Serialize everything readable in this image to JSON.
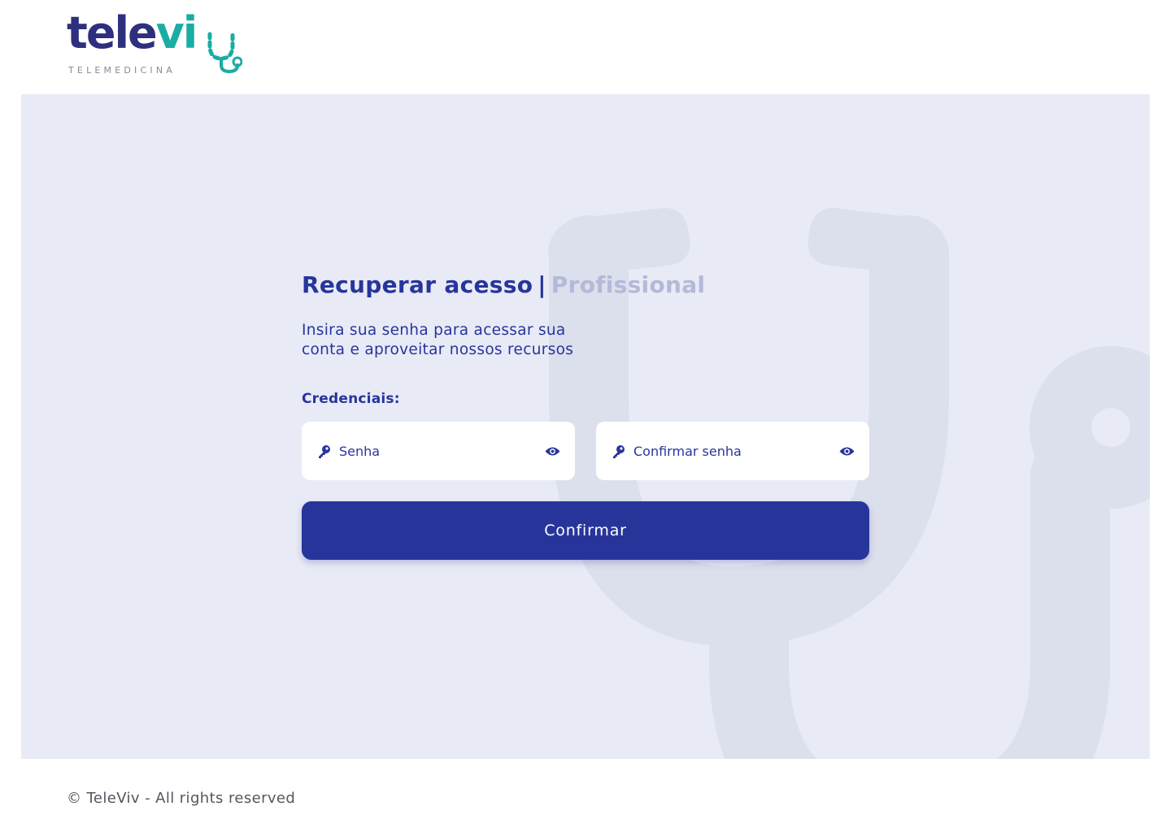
{
  "brand": {
    "logo_word_dark": "tele",
    "logo_word_teal": "vi",
    "logo_subtitle": "TELEMEDICINA",
    "colors": {
      "primary": "#27359b",
      "logo_dark": "#2e2f7d",
      "logo_teal": "#19ada3",
      "panel_bg": "#e8eaf6",
      "muted": "#b4b9d8"
    }
  },
  "form": {
    "title": "Recuperar acesso",
    "title_separator": "|",
    "title_role": "Profissional",
    "subtitle": "Insira sua senha para acessar sua conta e aproveitar nossos recursos",
    "credentials_label": "Credenciais:",
    "password": {
      "placeholder": "Senha",
      "value": "",
      "icon": "key-icon",
      "toggle_icon": "eye-icon"
    },
    "confirm_password": {
      "placeholder": "Confirmar senha",
      "value": "",
      "icon": "key-icon",
      "toggle_icon": "eye-icon"
    },
    "submit_label": "Confirmar"
  },
  "footer": {
    "copyright": "© TeleViv - All rights reserved"
  }
}
